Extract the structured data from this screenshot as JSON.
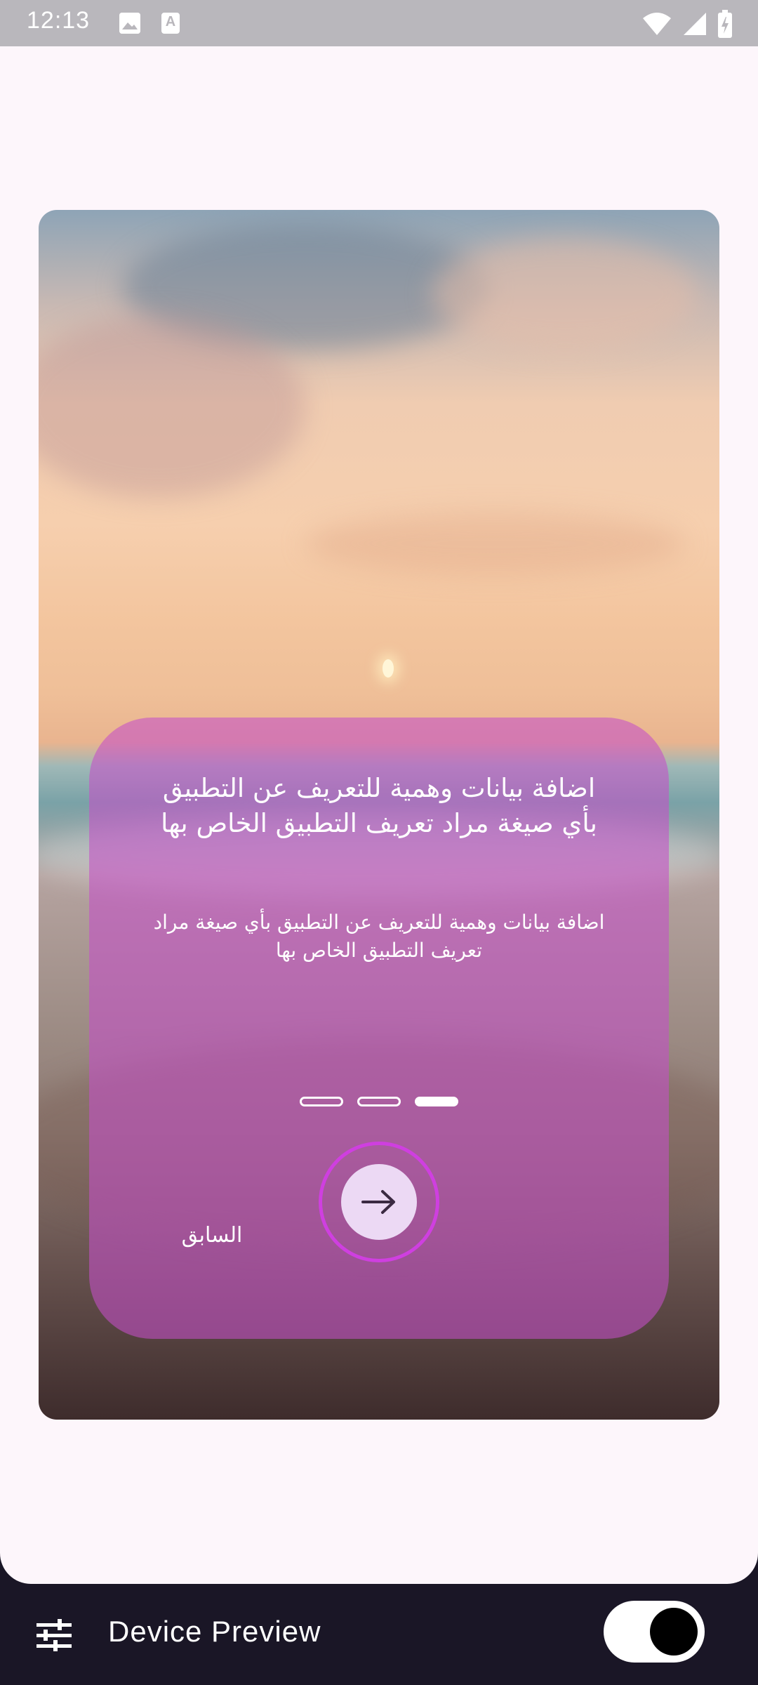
{
  "status_bar": {
    "time": "12:13",
    "notification_icons": [
      "image-icon",
      "a-icon"
    ],
    "a_glyph": "A",
    "right_icons": [
      "wifi-icon",
      "signal-icon",
      "battery-icon"
    ]
  },
  "onboarding": {
    "title": "اضافة بيانات وهمية للتعريف عن التطبيق بأي صيغة مراد تعريف التطبيق الخاص بها",
    "description": "اضافة بيانات وهمية للتعريف عن التطبيق بأي صيغة مراد تعريف التطبيق الخاص بها",
    "page_count": 3,
    "current_page": 3,
    "next_icon": "arrow-right-icon",
    "previous_label": "السابق",
    "panel_color": "#c450c8",
    "ring_color": "#cf3fe0"
  },
  "device_preview": {
    "settings_icon": "sliders-icon",
    "title": "Device Preview",
    "toggle_on": true
  }
}
